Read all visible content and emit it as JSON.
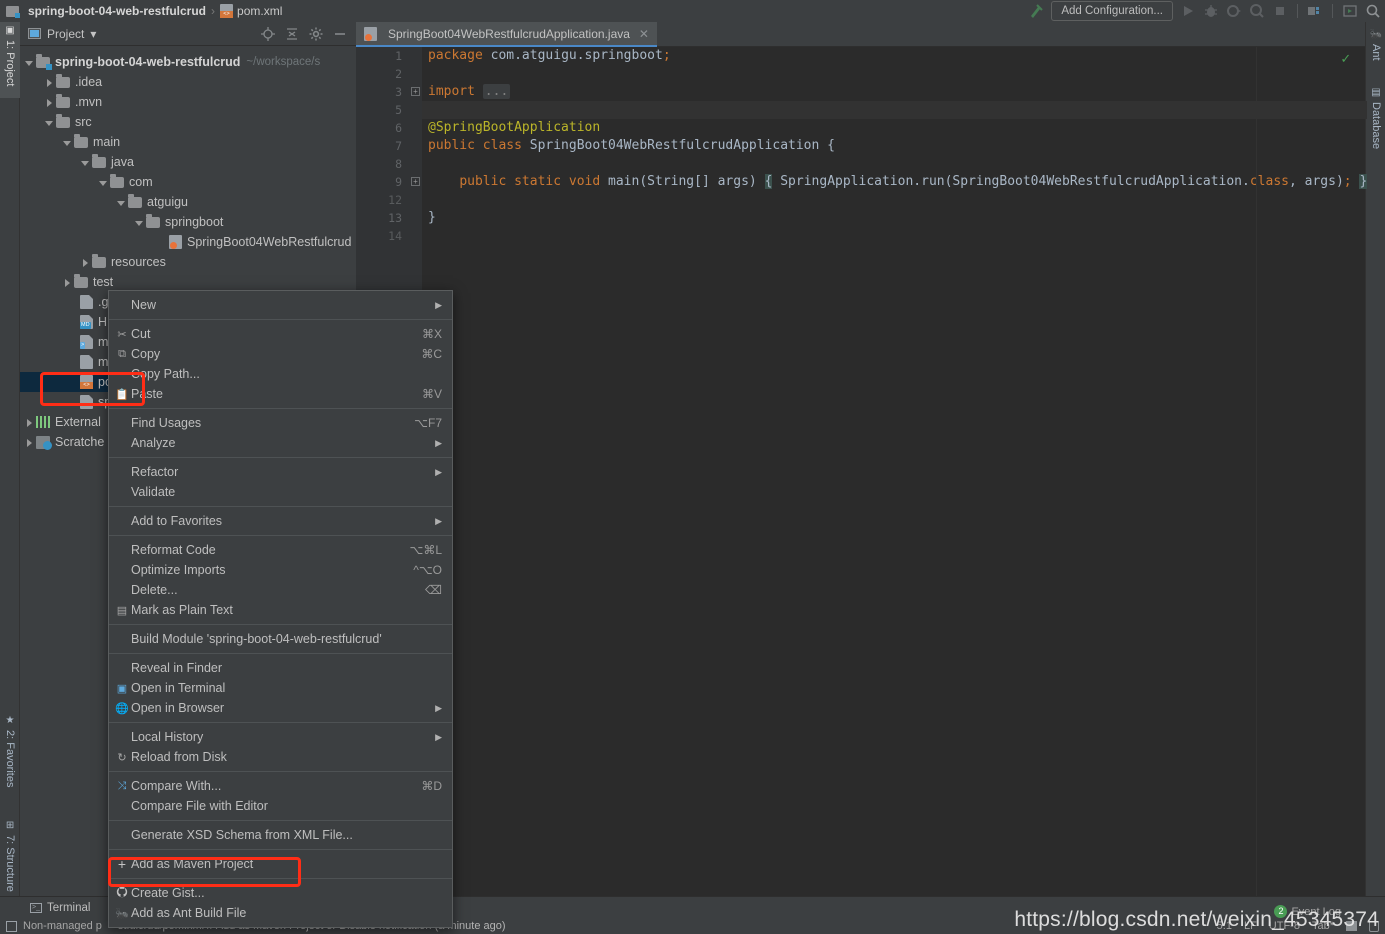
{
  "window": {
    "breadcrumb": [
      {
        "label": "spring-boot-04-web-restfulcrud",
        "icon": "module-icon",
        "bold": true
      },
      {
        "label": "pom.xml",
        "icon": "xml-file-icon",
        "bold": false
      }
    ]
  },
  "toolbar": {
    "add_configuration": "Add Configuration...",
    "icons": [
      "build-hammer-icon",
      "run-icon",
      "debug-icon",
      "run-coverage-icon",
      "profile-icon",
      "stop-icon",
      "project-structure-icon",
      "select-run-icon",
      "search-everywhere-icon"
    ]
  },
  "left_tool_strip": [
    {
      "label": "1: Project",
      "icon": "project-icon",
      "active": true
    },
    {
      "label": "2: Favorites",
      "icon": "star-icon",
      "active": false
    },
    {
      "label": "7: Structure",
      "icon": "structure-icon",
      "active": false
    }
  ],
  "right_tool_strip": [
    {
      "label": "Ant",
      "icon": "ant-icon"
    },
    {
      "label": "Database",
      "icon": "database-icon"
    }
  ],
  "project_panel": {
    "title": "Project",
    "dropdown_glyph": "▾",
    "header_icons": [
      "locate-icon",
      "collapse-all-icon",
      "settings-gear-icon",
      "hide-icon"
    ],
    "tree": [
      {
        "indent": 0,
        "arrow": "open",
        "icon": "module-folder-icon",
        "label": "spring-boot-04-web-restfulcrud",
        "bold": true,
        "path": "~/workspace/s",
        "selected": false
      },
      {
        "indent": 1,
        "arrow": "closed",
        "icon": "folder-icon",
        "label": ".idea",
        "bold": false,
        "path": "",
        "selected": false
      },
      {
        "indent": 1,
        "arrow": "closed",
        "icon": "folder-icon",
        "label": ".mvn",
        "bold": false,
        "path": "",
        "selected": false
      },
      {
        "indent": 1,
        "arrow": "open",
        "icon": "folder-icon",
        "label": "src",
        "bold": false,
        "path": "",
        "selected": false
      },
      {
        "indent": 2,
        "arrow": "open",
        "icon": "folder-icon",
        "label": "main",
        "bold": false,
        "path": "",
        "selected": false
      },
      {
        "indent": 3,
        "arrow": "open",
        "icon": "folder-icon",
        "label": "java",
        "bold": false,
        "path": "",
        "selected": false
      },
      {
        "indent": 4,
        "arrow": "open",
        "icon": "folder-icon",
        "label": "com",
        "bold": false,
        "path": "",
        "selected": false
      },
      {
        "indent": 5,
        "arrow": "open",
        "icon": "folder-icon",
        "label": "atguigu",
        "bold": false,
        "path": "",
        "selected": false
      },
      {
        "indent": 6,
        "arrow": "open",
        "icon": "folder-icon",
        "label": "springboot",
        "bold": false,
        "path": "",
        "selected": false
      },
      {
        "indent": 7,
        "arrow": "none",
        "icon": "java-class-icon",
        "label": "SpringBoot04WebRestfulcrud",
        "bold": false,
        "path": "",
        "selected": false
      },
      {
        "indent": 3,
        "arrow": "closed",
        "icon": "folder-icon",
        "label": "resources",
        "bold": false,
        "path": "",
        "selected": false
      },
      {
        "indent": 2,
        "arrow": "closed",
        "icon": "folder-icon",
        "label": "test",
        "bold": false,
        "path": "",
        "selected": false
      },
      {
        "indent": 2,
        "arrow": "none",
        "icon": "gitignore-file-icon",
        "label": ".gitign",
        "bold": false,
        "path": "",
        "selected": false
      },
      {
        "indent": 2,
        "arrow": "none",
        "icon": "markdown-file-icon",
        "label": "HELP",
        "bold": false,
        "path": "",
        "selected": false
      },
      {
        "indent": 2,
        "arrow": "none",
        "icon": "shell-script-icon",
        "label": "mvnw",
        "bold": false,
        "path": "",
        "selected": false
      },
      {
        "indent": 2,
        "arrow": "none",
        "icon": "text-file-icon",
        "label": "mvnw",
        "bold": false,
        "path": "",
        "selected": false
      },
      {
        "indent": 2,
        "arrow": "none",
        "icon": "xml-file-icon",
        "label": "pom.x",
        "bold": false,
        "path": "",
        "selected": true
      },
      {
        "indent": 2,
        "arrow": "none",
        "icon": "iml-file-icon",
        "label": "spring",
        "bold": false,
        "path": "",
        "selected": false
      },
      {
        "indent": 0,
        "arrow": "closed",
        "icon": "external-libraries-icon",
        "label": "External",
        "bold": false,
        "path": "",
        "selected": false
      },
      {
        "indent": 0,
        "arrow": "closed",
        "icon": "scratches-icon",
        "label": "Scratche",
        "bold": false,
        "path": "",
        "selected": false
      }
    ]
  },
  "editor": {
    "tab": {
      "label": "SpringBoot04WebRestfulcrudApplication.java",
      "icon": "java-class-icon",
      "close_glyph": "✕"
    },
    "inspection_ok_glyph": "✓",
    "lines": [
      {
        "num": "1",
        "fold": "",
        "text": "package com.atguigu.springboot;"
      },
      {
        "num": "2",
        "fold": "",
        "text": ""
      },
      {
        "num": "3",
        "fold": "+",
        "text": "import ..."
      },
      {
        "num": "5",
        "fold": "",
        "text": ""
      },
      {
        "num": "6",
        "fold": "",
        "text": "@SpringBootApplication"
      },
      {
        "num": "7",
        "fold": "",
        "text": "public class SpringBoot04WebRestfulcrudApplication {"
      },
      {
        "num": "8",
        "fold": "",
        "text": ""
      },
      {
        "num": "9",
        "fold": "+",
        "text": "    public static void main(String[] args) { SpringApplication.run(SpringBoot04WebRestfulcrudApplication.class, args); }"
      },
      {
        "num": "12",
        "fold": "",
        "text": ""
      },
      {
        "num": "13",
        "fold": "",
        "text": "}"
      },
      {
        "num": "14",
        "fold": "",
        "text": ""
      }
    ]
  },
  "context_menu": {
    "items": [
      {
        "kind": "item",
        "icon": "",
        "label": "New",
        "key": "",
        "submenu": true
      },
      {
        "kind": "sep"
      },
      {
        "kind": "item",
        "icon": "cut-icon",
        "label": "Cut",
        "key": "⌘X",
        "submenu": false
      },
      {
        "kind": "item",
        "icon": "copy-icon",
        "label": "Copy",
        "key": "",
        "submenu": false
      },
      {
        "kind": "item",
        "icon": "",
        "label": "Copy Path...",
        "key": "",
        "submenu": false
      },
      {
        "kind": "item",
        "icon": "paste-icon",
        "label": "Paste",
        "key": "⌘V",
        "submenu": false
      },
      {
        "kind": "sep"
      },
      {
        "kind": "item",
        "icon": "",
        "label": "Find Usages",
        "key": "⌥F7",
        "submenu": false
      },
      {
        "kind": "item",
        "icon": "",
        "label": "Analyze",
        "key": "",
        "submenu": true
      },
      {
        "kind": "sep"
      },
      {
        "kind": "item",
        "icon": "",
        "label": "Refactor",
        "key": "",
        "submenu": true
      },
      {
        "kind": "item",
        "icon": "",
        "label": "Validate",
        "key": "",
        "submenu": false
      },
      {
        "kind": "sep"
      },
      {
        "kind": "item",
        "icon": "",
        "label": "Add to Favorites",
        "key": "",
        "submenu": true
      },
      {
        "kind": "sep"
      },
      {
        "kind": "item",
        "icon": "",
        "label": "Reformat Code",
        "key": "⌥⌘L",
        "submenu": false
      },
      {
        "kind": "item",
        "icon": "",
        "label": "Optimize Imports",
        "key": "^⌥O",
        "submenu": false
      },
      {
        "kind": "item",
        "icon": "",
        "label": "Delete...",
        "key": "⌫",
        "submenu": false
      },
      {
        "kind": "item",
        "icon": "plain-text-icon",
        "label": "Mark as Plain Text",
        "key": "",
        "submenu": false
      },
      {
        "kind": "sep"
      },
      {
        "kind": "item",
        "icon": "",
        "label": "Build Module 'spring-boot-04-web-restfulcrud'",
        "key": "",
        "submenu": false
      },
      {
        "kind": "sep"
      },
      {
        "kind": "item",
        "icon": "",
        "label": "Reveal in Finder",
        "key": "",
        "submenu": false
      },
      {
        "kind": "item",
        "icon": "terminal-icon",
        "label": "Open in Terminal",
        "key": "",
        "submenu": false
      },
      {
        "kind": "item",
        "icon": "browser-globe-icon",
        "label": "Open in Browser",
        "key": "",
        "submenu": true
      },
      {
        "kind": "sep"
      },
      {
        "kind": "item",
        "icon": "",
        "label": "Local History",
        "key": "",
        "submenu": true
      },
      {
        "kind": "item",
        "icon": "reload-icon",
        "label": "Reload from Disk",
        "key": "",
        "submenu": false
      },
      {
        "kind": "sep"
      },
      {
        "kind": "item",
        "icon": "compare-icon",
        "label": "Compare With...",
        "key": "⌘D",
        "submenu": false
      },
      {
        "kind": "item",
        "icon": "",
        "label": "Compare File with Editor",
        "key": "",
        "submenu": false
      },
      {
        "kind": "sep"
      },
      {
        "kind": "item",
        "icon": "",
        "label": "Generate XSD Schema from XML File...",
        "key": "",
        "submenu": false
      },
      {
        "kind": "sep"
      },
      {
        "kind": "item",
        "icon": "plus-icon",
        "label": "Add as Maven Project",
        "key": "",
        "submenu": false
      },
      {
        "kind": "sep"
      },
      {
        "kind": "item",
        "icon": "github-icon",
        "label": "Create Gist...",
        "key": "",
        "submenu": false
      },
      {
        "kind": "item",
        "icon": "ant-bug-icon",
        "label": "Add as Ant Build File",
        "key": "",
        "submenu": false
      }
    ]
  },
  "bottom": {
    "tabs": [
      {
        "label": "Terminal",
        "icon": "terminal-icon"
      }
    ],
    "status_left": "Non-managed p",
    "status_message": "stfulcrud/pom.xml // Add as Maven Project or Disable notification (a minute ago)",
    "event_log": "Event Log",
    "event_count": "2",
    "caret": "5:1",
    "line_sep": "LF",
    "encoding": "UTF-8",
    "indent": "Tab*"
  },
  "watermark": "https://blog.csdn.net/weixin_45345374",
  "colors": {
    "panel_bg": "#3c3f41",
    "editor_bg": "#2b2b2b",
    "gutter_bg": "#313335",
    "selection_bg": "#0d293e",
    "accent_blue": "#4a88c7",
    "highlight_red": "#ff2d16",
    "keyword_orange": "#cc7832",
    "annotation_yellow": "#bbb529",
    "ok_green": "#499c54"
  }
}
